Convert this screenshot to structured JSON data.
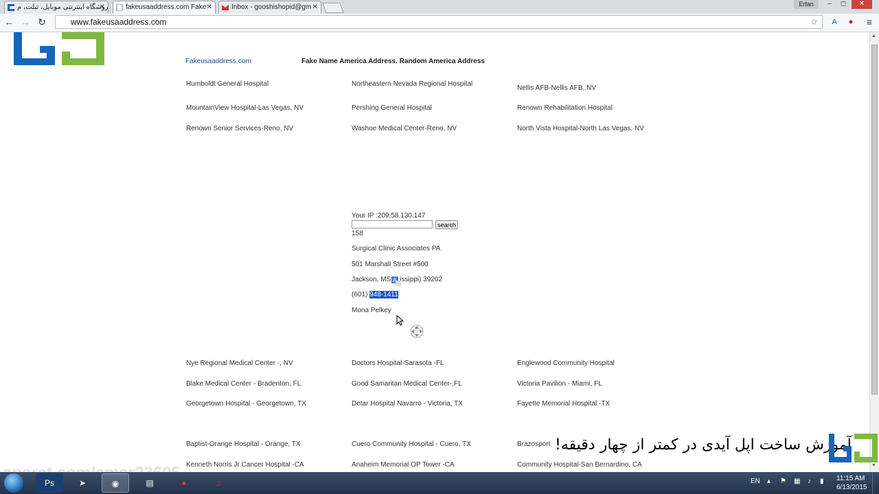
{
  "browser": {
    "tabs": [
      {
        "title": "فروشگاه اینترنتی موبایل، تبلت، م",
        "active": false
      },
      {
        "title": "fakeusaaddress.com Fake",
        "active": true
      },
      {
        "title": "Inbox - gooshishopid@gm",
        "active": false
      }
    ],
    "user_badge": "Erfan",
    "url": "www.fakeusaaddress.com"
  },
  "page": {
    "site_link": "Fakeusaaddress.com",
    "site_title": "Fake Name America Address. Random America Address",
    "hospital_rows_top": [
      [
        "Humboldt General Hospital",
        "Northeastern Nevada Regional Hospital",
        "Nellis AFB-Nellis AFB, NV"
      ],
      [
        "MountainView Hospital-Las Vegas, NV",
        "Pershing General Hospital",
        "Renown Rehabilitation Hospital"
      ],
      [
        "Renown Senior Services-Reno, NV",
        "Washoe Medical Center-Reno, NV",
        "North Vista Hospital-North Las Vegas, NV"
      ]
    ],
    "ip_text": "Your IP :209.58.130.147",
    "search_button": "search",
    "result": {
      "number": "158",
      "name": "Surgical Clinic Associates PA",
      "street": "501 Marshall Street #500",
      "city_before": "Jackson, MS",
      "city_after": "issippi) 39202",
      "phone_prefix": "(601) ",
      "phone_selected": "948-1411",
      "person": "Mona Pelkey"
    },
    "hospital_rows_bottom": [
      [
        "Nye Regional Medical Center -, NV",
        "Doctors Hospital-Sarasota -FL",
        "Englewood Community Hospital"
      ],
      [
        "Blake Medical Center - Bradenton, FL",
        "Good Samaritan Medical Center-,FL",
        "Victoria Pavilion - Miami, FL"
      ],
      [
        "Georgetown Hospital - Georgetown, TX",
        "Detar Hospital Navarro - Victoria, TX",
        "Fayette Memorial Hospital -TX"
      ],
      [
        "Baptist-Orange Hospital - Orange, TX",
        "Cuero Community Hospital - Cuero, TX",
        "Brazosport"
      ],
      [
        "Kenneth Norris Jr Cancer Hospital -CA",
        "Anaheim Memorial OP Tower -CA",
        "Community Hospital-San Bernardino, CA"
      ]
    ]
  },
  "overlay": {
    "caption": "آموزش ساخت اپل آیدی در کمتر از چهار دقیقه!",
    "watermark": "aparat.com/amer23605"
  },
  "taskbar": {
    "language": "EN",
    "time": "11:15 AM",
    "date": "6/13/2015"
  },
  "colors": {
    "logo_blue": "#1565b8",
    "logo_green": "#7fb842",
    "selection": "#1a56c9",
    "link": "#1a4f91"
  }
}
